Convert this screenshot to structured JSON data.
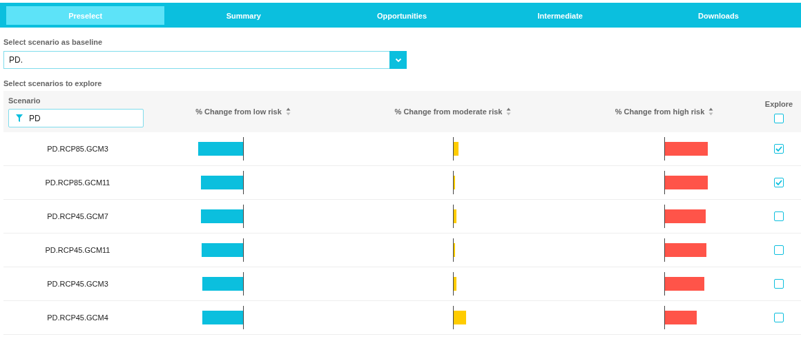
{
  "tabs": [
    {
      "label": "Preselect",
      "selected": true
    },
    {
      "label": "Summary",
      "selected": false
    },
    {
      "label": "Opportunities",
      "selected": false
    },
    {
      "label": "Intermediate",
      "selected": false
    },
    {
      "label": "Downloads",
      "selected": false
    }
  ],
  "baseline": {
    "label": "Select scenario as baseline",
    "value": "PD."
  },
  "explore_label": "Select scenarios to explore",
  "table": {
    "scenario_header": "Scenario",
    "filter": {
      "value": "PD"
    },
    "columns": [
      {
        "label": "% Change from low risk",
        "kind": "negative",
        "color": "#0bbfde"
      },
      {
        "label": "% Change from moderate risk",
        "kind": "positive",
        "color": "#ffcc00"
      },
      {
        "label": "% Change from high risk",
        "kind": "positive",
        "color": "#ff5449"
      }
    ],
    "explore_header": {
      "label": "Explore",
      "checked": false
    },
    "rows": [
      {
        "scenario": "PD.RCP85.GCM3",
        "bars": [
          {
            "level": 0.65
          },
          {
            "level": 0.07
          },
          {
            "level": 0.62
          }
        ],
        "checked": true
      },
      {
        "scenario": "PD.RCP85.GCM11",
        "bars": [
          {
            "level": 0.61
          },
          {
            "level": 0.02
          },
          {
            "level": 0.62
          }
        ],
        "checked": true
      },
      {
        "scenario": "PD.RCP45.GCM7",
        "bars": [
          {
            "level": 0.61
          },
          {
            "level": 0.04
          },
          {
            "level": 0.59
          }
        ],
        "checked": false
      },
      {
        "scenario": "PD.RCP45.GCM11",
        "bars": [
          {
            "level": 0.6
          },
          {
            "level": 0.02
          },
          {
            "level": 0.6
          }
        ],
        "checked": false
      },
      {
        "scenario": "PD.RCP45.GCM3",
        "bars": [
          {
            "level": 0.59
          },
          {
            "level": 0.04
          },
          {
            "level": 0.57
          }
        ],
        "checked": false
      },
      {
        "scenario": "PD.RCP45.GCM4",
        "bars": [
          {
            "level": 0.59
          },
          {
            "level": 0.18
          },
          {
            "level": 0.46
          }
        ],
        "checked": false
      }
    ]
  }
}
